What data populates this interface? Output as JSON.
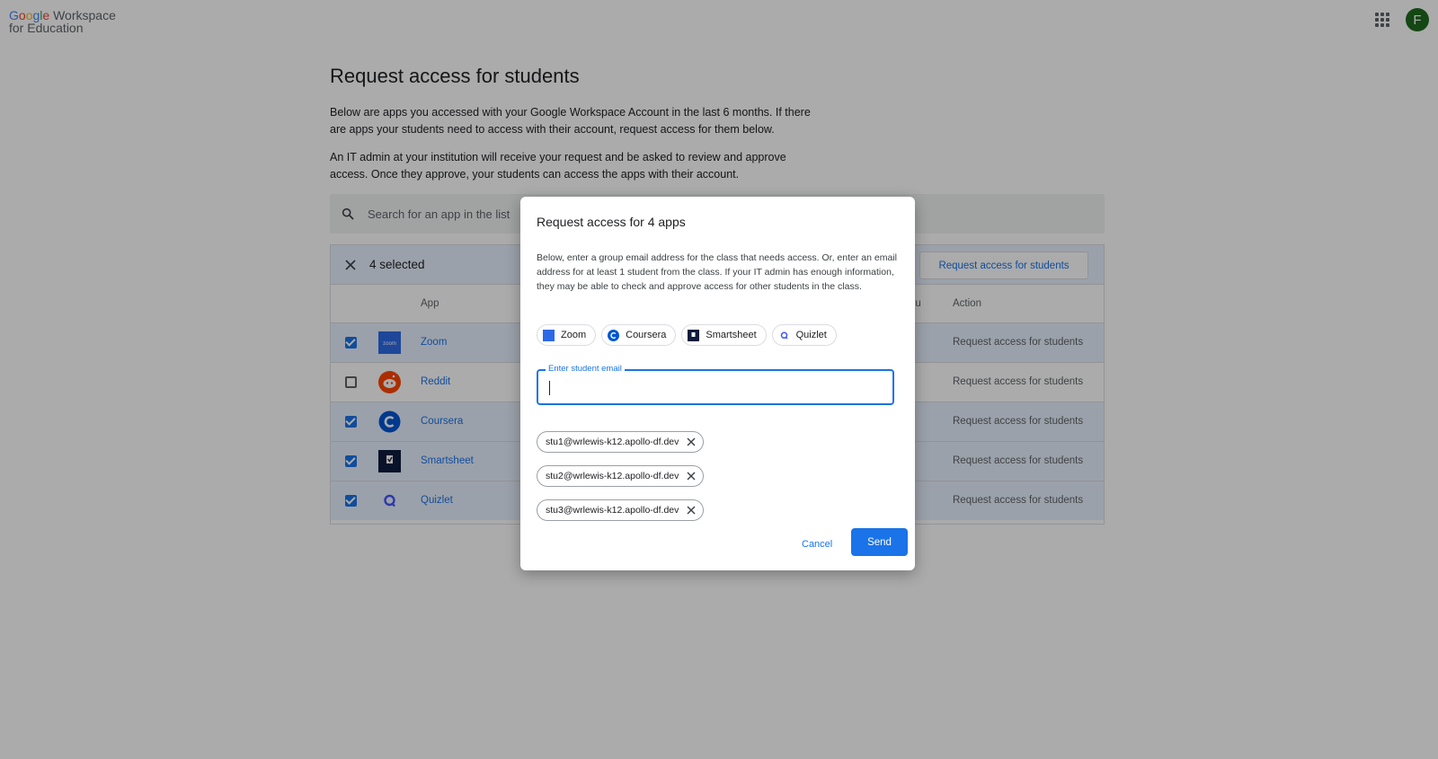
{
  "brand": {
    "google": "Google",
    "workspace": "Workspace",
    "line2": "for Education"
  },
  "header": {
    "avatar_letter": "F"
  },
  "main": {
    "title": "Request access for students",
    "para1": "Below are apps you accessed with your Google Workspace Account in the last 6 months. If there are apps your students need to access with their account, request access for them below.",
    "para2": "An IT admin at your institution will receive your request and be asked to review and approve access. Once they approve, your students can access the apps with their account.",
    "search_placeholder": "Search for an app in the list",
    "selected_count": "4 selected",
    "request_button": "Request access for students",
    "columns": {
      "app": "App",
      "you": "ou",
      "action": "Action"
    },
    "rows": [
      {
        "name": "Zoom",
        "checked": true,
        "action": "Request access for students"
      },
      {
        "name": "Reddit",
        "checked": false,
        "action": "Request access for students"
      },
      {
        "name": "Coursera",
        "checked": true,
        "action": "Request access for students"
      },
      {
        "name": "Smartsheet",
        "checked": true,
        "action": "Request access for students"
      },
      {
        "name": "Quizlet",
        "checked": true,
        "action": "Request access for students"
      }
    ]
  },
  "dialog": {
    "title": "Request access for 4 apps",
    "description": "Below, enter a group email address for the class that needs access. Or, enter an email address for at least 1 student from the class. If your IT admin has enough information, they may be able to check and approve access for other students in the class.",
    "app_chips": [
      "Zoom",
      "Coursera",
      "Smartsheet",
      "Quizlet"
    ],
    "email_label": "Enter student email",
    "emails": [
      "stu1@wrlewis-k12.apollo-df.dev",
      "stu2@wrlewis-k12.apollo-df.dev",
      "stu3@wrlewis-k12.apollo-df.dev"
    ],
    "cancel": "Cancel",
    "send": "Send"
  },
  "colors": {
    "accent": "#1a73e8",
    "avatar": "#1e6b1e",
    "selected_row": "#e8f0fe"
  }
}
